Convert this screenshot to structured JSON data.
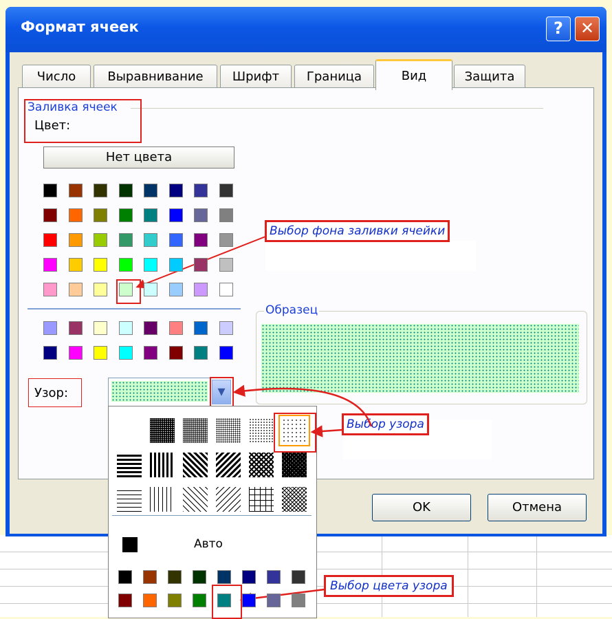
{
  "window": {
    "title": "Формат ячеек",
    "help": "?",
    "close": "✕"
  },
  "tabs": [
    {
      "label": "Число"
    },
    {
      "label": "Выравнивание"
    },
    {
      "label": "Шрифт"
    },
    {
      "label": "Граница"
    },
    {
      "label": "Вид",
      "active": true
    },
    {
      "label": "Защита"
    }
  ],
  "fill": {
    "group_title": "Заливка ячеек",
    "color_label": "Цвет:",
    "no_color": "Нет цвета",
    "palette_main": [
      [
        "#000000",
        "#993300",
        "#333300",
        "#003300",
        "#003366",
        "#000080",
        "#333399",
        "#333333"
      ],
      [
        "#800000",
        "#ff6600",
        "#808000",
        "#008000",
        "#008080",
        "#0000ff",
        "#666699",
        "#808080"
      ],
      [
        "#ff0000",
        "#ff9900",
        "#99cc00",
        "#339966",
        "#33cccc",
        "#3366ff",
        "#800080",
        "#969696"
      ],
      [
        "#ff00ff",
        "#ffcc00",
        "#ffff00",
        "#00ff00",
        "#00ffff",
        "#00ccff",
        "#993366",
        "#c0c0c0"
      ],
      [
        "#ff99cc",
        "#ffcc99",
        "#ffff99",
        "#ccffcc",
        "#ccffff",
        "#99ccff",
        "#cc99ff",
        "#ffffff"
      ]
    ],
    "palette_extra": [
      [
        "#9999ff",
        "#993366",
        "#ffffcc",
        "#ccffff",
        "#660066",
        "#ff8080",
        "#0066cc",
        "#ccccff"
      ],
      [
        "#000080",
        "#ff00ff",
        "#ffff00",
        "#00ffff",
        "#800080",
        "#800000",
        "#008080",
        "#0000ff"
      ]
    ],
    "selected_color": "#ccffcc"
  },
  "sample": {
    "label": "Образец",
    "bg": "#ccffcc",
    "dot": "#008080"
  },
  "pattern": {
    "label": "Узор:",
    "dropdown_arrow": "▾"
  },
  "dropdown": {
    "auto_label": "Авто",
    "colors_row1": [
      "#000000",
      "#993300",
      "#333300",
      "#003300",
      "#003366",
      "#000080",
      "#333399",
      "#333333"
    ],
    "colors_row2": [
      "#800000",
      "#ff6600",
      "#808000",
      "#008000",
      "#008080",
      "#0000ff",
      "#666699",
      "#808080"
    ]
  },
  "buttons": {
    "ok": "OK",
    "cancel": "Отмена"
  },
  "annotations": {
    "fill_bg": "Выбор фона заливки ячейки",
    "pattern": "Выбор узора",
    "pattern_color": "Выбор цвета узора"
  },
  "colors": {
    "accent": "#e0201c",
    "title_blue": "#0a54e2",
    "annotation_text": "#1230c8"
  }
}
